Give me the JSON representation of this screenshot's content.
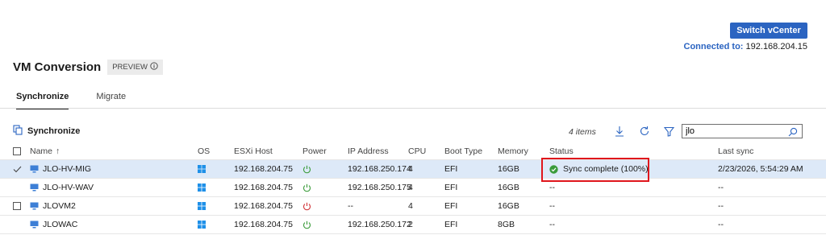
{
  "header": {
    "switch_button": "Switch vCenter",
    "connected_label": "Connected to:",
    "connected_value": "192.168.204.15"
  },
  "page": {
    "title": "VM Conversion",
    "badge": "PREVIEW"
  },
  "tabs": [
    {
      "label": "Synchronize",
      "active": true
    },
    {
      "label": "Migrate",
      "active": false
    }
  ],
  "toolbar": {
    "action_label": "Synchronize",
    "items_count": "4 items",
    "search_value": "jlo",
    "icons": [
      "download-icon",
      "refresh-icon",
      "filter-icon",
      "search-icon"
    ]
  },
  "table": {
    "columns": [
      "Name",
      "OS",
      "ESXi Host",
      "Power",
      "IP Address",
      "CPU",
      "Boot Type",
      "Memory",
      "Status",
      "Last sync"
    ],
    "sort_indicator": "↑",
    "rows": [
      {
        "name": "JLO-HV-MIG",
        "host": "192.168.204.75",
        "power": "on",
        "ip": "192.168.250.174",
        "cpu": "4",
        "boot": "EFI",
        "memory": "16GB",
        "status": "Sync complete (100%)",
        "last_sync": "2/23/2026, 5:54:29 AM",
        "selected": true
      },
      {
        "name": "JLO-HV-WAV",
        "host": "192.168.204.75",
        "power": "on",
        "ip": "192.168.250.175",
        "cpu": "4",
        "boot": "EFI",
        "memory": "16GB",
        "status": "--",
        "last_sync": "--",
        "selected": false
      },
      {
        "name": "JLOVM2",
        "host": "192.168.204.75",
        "power": "off",
        "ip": "--",
        "cpu": "4",
        "boot": "EFI",
        "memory": "16GB",
        "status": "--",
        "last_sync": "--",
        "selected": false
      },
      {
        "name": "JLOWAC",
        "host": "192.168.204.75",
        "power": "on",
        "ip": "192.168.250.172",
        "cpu": "2",
        "boot": "EFI",
        "memory": "8GB",
        "status": "--",
        "last_sync": "--",
        "selected": false
      }
    ]
  },
  "colors": {
    "accent": "#2b64c1",
    "power_on": "#3a9b3a",
    "power_off": "#d13438",
    "success": "#3a9b3a",
    "highlight": "#e0161c",
    "windows": "#1e90e8"
  }
}
